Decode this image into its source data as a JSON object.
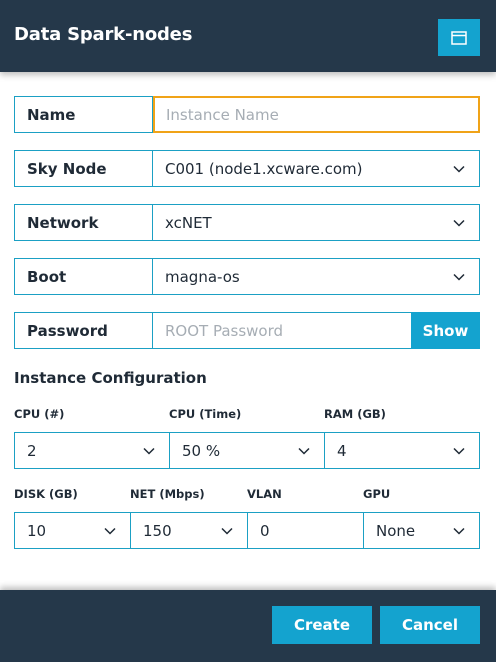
{
  "header": {
    "title": "Data Spark-nodes",
    "icon": "window-icon"
  },
  "form": {
    "name": {
      "label": "Name",
      "placeholder": "Instance Name",
      "value": ""
    },
    "sky_node": {
      "label": "Sky Node",
      "value": "C001 (node1.xcware.com)"
    },
    "network": {
      "label": "Network",
      "value": "xcNET"
    },
    "boot": {
      "label": "Boot",
      "value": "magna-os"
    },
    "password": {
      "label": "Password",
      "placeholder": "ROOT Password",
      "show_label": "Show"
    }
  },
  "instance_config": {
    "title": "Instance Configuration",
    "cpu_count": {
      "label": "CPU (#)",
      "value": "2"
    },
    "cpu_time": {
      "label": "CPU (Time)",
      "value": "50 %"
    },
    "ram": {
      "label": "RAM (GB)",
      "value": "4"
    },
    "disk": {
      "label": "DISK (GB)",
      "value": "10"
    },
    "net": {
      "label": "NET (Mbps)",
      "value": "150"
    },
    "vlan": {
      "label": "VLAN",
      "value": "0"
    },
    "gpu": {
      "label": "GPU",
      "value": "None"
    }
  },
  "footer": {
    "create_label": "Create",
    "cancel_label": "Cancel"
  },
  "colors": {
    "header_bg": "#25384a",
    "accent": "#14a3cf",
    "focus_border": "#f0a318"
  }
}
